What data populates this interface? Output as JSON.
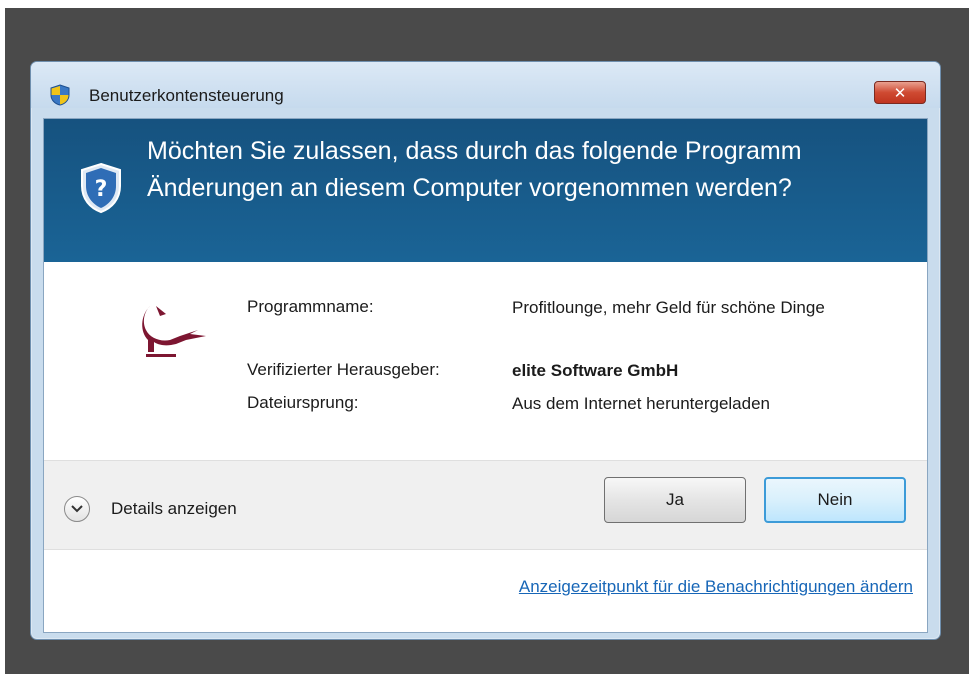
{
  "window": {
    "title": "Benutzerkontensteuerung",
    "close_label": "✕"
  },
  "header": {
    "question": "Möchten Sie zulassen, dass durch das folgende Programm Änderungen an diesem Computer vorgenommen werden?"
  },
  "details": {
    "program_label": "Programmname:",
    "program_value": "Profitlounge, mehr Geld für schöne Dinge",
    "publisher_label": "Verifizierter Herausgeber:",
    "publisher_value": "elite Software GmbH",
    "origin_label": "Dateiursprung:",
    "origin_value": "Aus dem Internet heruntergeladen"
  },
  "actions": {
    "details_toggle": "Details anzeigen",
    "yes_label": "Ja",
    "no_label": "Nein"
  },
  "footer": {
    "link_text": "Anzeigezeitpunkt für die Benachrichtigungen ändern"
  },
  "icons": {
    "title": "uac-shield-icon",
    "header": "question-shield-icon",
    "program": "bird-logo-icon",
    "toggle": "chevron-down-icon"
  },
  "colors": {
    "header_bg": "#1a6496",
    "link": "#1766b7",
    "backdrop": "#4a4a4a"
  }
}
